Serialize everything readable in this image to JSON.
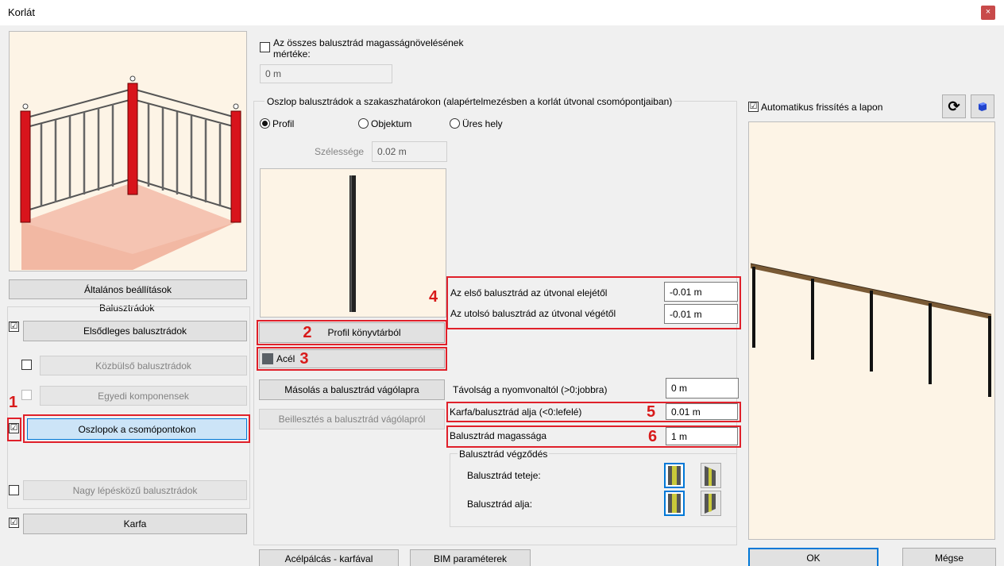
{
  "window": {
    "title": "Korlát",
    "close": "×"
  },
  "left": {
    "general_settings": "Általános beállítások",
    "balusters_header": "Balusztrádok",
    "items": [
      {
        "label": "Elsődleges balusztrádok",
        "checked": true
      },
      {
        "label": "Közbülső balusztrádok",
        "checked": false
      },
      {
        "label": "Egyedi komponensek",
        "checked": false
      },
      {
        "label": "Oszlopok a csomópontokon",
        "checked": true
      },
      {
        "label": "Nagy lépésközű balusztrádok",
        "checked": false
      },
      {
        "label": "Karfa",
        "checked": true
      }
    ]
  },
  "middle": {
    "all_height_check_label": "Az összes balusztrád magasságnövelésének mértéke:",
    "all_height_value": "0 m",
    "group_title": "Oszlop balusztrádok a szakaszhatárokon (alapértelmezésben a korlát útvonal csomópontjaiban)",
    "radios": [
      "Profil",
      "Objektum",
      "Üres hely"
    ],
    "width_label": "Szélessége",
    "width_value": "0.02 m",
    "profile_library_btn": "Profil könyvtárból",
    "material_btn": "Acél",
    "copy_btn": "Másolás a balusztrád vágólapra",
    "paste_btn": "Beillesztés a balusztrád vágólapról",
    "bottom_btn_1": "Acélpálcás - karfával",
    "bottom_btn_2": "BIM paraméterek"
  },
  "params": {
    "first_label": "Az első balusztrád az útvonal elejétől",
    "first_value": "-0.01 m",
    "last_label": "Az utolsó balusztrád az útvonal végétől",
    "last_value": "-0.01 m",
    "distance_label": "Távolság a nyomvonaltól (>0:jobbra)",
    "distance_value": "0 m",
    "bottom_label": "Karfa/balusztrád alja (<0:lefelé)",
    "bottom_value": "0.01 m",
    "height_label": "Balusztrád magassága",
    "height_value": "1 m",
    "ending_group": "Balusztrád végződés",
    "top_label": "Balusztrád teteje:",
    "bottom_end_label": "Balusztrád alja:"
  },
  "right": {
    "auto_refresh_label": "Automatikus frissítés a lapon",
    "ok": "OK",
    "cancel": "Mégse"
  },
  "annotations": {
    "n1": "1",
    "n2": "2",
    "n3": "3",
    "n4": "4",
    "n5": "5",
    "n6": "6"
  },
  "colors": {
    "accent": "#0078d7",
    "annotation_red": "#e0202a",
    "post_red": "#d8141c",
    "preview_bg": "#fdf4e6"
  }
}
